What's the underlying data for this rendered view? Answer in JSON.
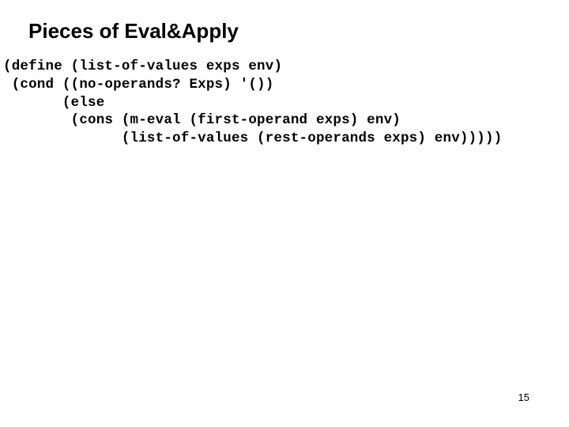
{
  "title": "Pieces of Eval&Apply",
  "code": {
    "line1": "(define (list-of-values exps env)",
    "line2": " (cond ((no-operands? Exps) '())",
    "line3": "       (else",
    "line4": "        (cons (m-eval (first-operand exps) env)",
    "line5": "              (list-of-values (rest-operands exps) env)))))"
  },
  "page_number": "15"
}
